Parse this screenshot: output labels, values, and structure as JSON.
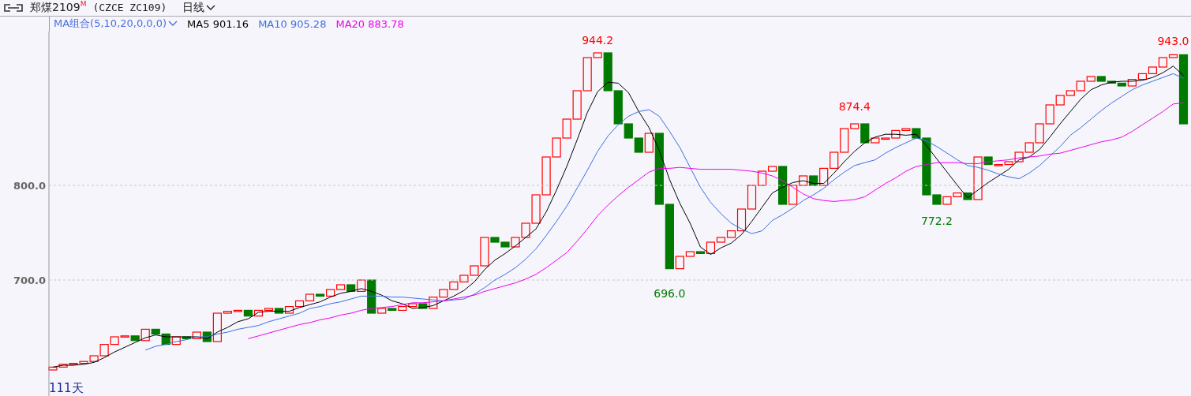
{
  "toolbar": {
    "title": "郑煤2109$^{M}$",
    "code": "(CZCE ZC109)",
    "period": "日线"
  },
  "legend": {
    "group": "MA组合(5,10,20,0,0,0)",
    "items": [
      {
        "value": "901.16"
      },
      {
        "value": "905.28"
      },
      {
        "value": "883.78"
      }
    ]
  },
  "chart_data": {
    "type": "line",
    "ylim": [
      577.5,
      962.5
    ],
    "yticks": [
      {
        "value": 700,
        "label": "700.0"
      },
      {
        "value": 800,
        "label": "800.0"
      }
    ],
    "series": [
      {
        "name": "MA5",
        "color": "#000000",
        "values": [
          608,
          610,
          610,
          611,
          613,
          618,
          624,
          629,
          634,
          639,
          642,
          640,
          640,
          640,
          640,
          638,
          645,
          650,
          656,
          659,
          666,
          667,
          667,
          667,
          671,
          674,
          677,
          682,
          686,
          688,
          691,
          688,
          684,
          678,
          675,
          670,
          671,
          673,
          678,
          683,
          689,
          698,
          711,
          721,
          728,
          736,
          745,
          754,
          772,
          795,
          820,
          848,
          877,
          899,
          909,
          908,
          898,
          878,
          861,
          837,
          806,
          781,
          760,
          735,
          727,
          734,
          739,
          748,
          762,
          777,
          792,
          798,
          803,
          805,
          802,
          802,
          813,
          825,
          836,
          845,
          851,
          854,
          854,
          853,
          854,
          842,
          828,
          814,
          800,
          787,
          795,
          803,
          810,
          817,
          827,
          830,
          838,
          851,
          865,
          878,
          891,
          901,
          906,
          909,
          910,
          910,
          911,
          914,
          919,
          926,
          916
        ]
      },
      {
        "name": "MA10",
        "color": "#3b6fe0",
        "values": [
          null,
          null,
          null,
          null,
          null,
          null,
          null,
          null,
          null,
          626,
          630,
          632,
          635,
          637,
          640,
          640,
          643,
          645,
          648,
          650,
          652,
          656,
          659,
          662,
          665,
          670,
          672,
          675,
          677,
          680,
          683,
          683,
          683,
          682,
          682,
          681,
          680,
          679,
          678,
          679,
          680,
          685,
          692,
          700,
          706,
          713,
          722,
          733,
          747,
          762,
          778,
          797,
          816,
          836,
          852,
          864,
          873,
          878,
          880,
          873,
          857,
          840,
          819,
          798,
          782,
          770,
          760,
          754,
          749,
          752,
          763,
          769,
          776,
          784,
          790,
          797,
          806,
          814,
          821,
          824,
          827,
          834,
          840,
          845,
          850,
          847,
          841,
          834,
          827,
          821,
          819,
          816,
          812,
          809,
          807,
          813,
          821,
          831,
          841,
          853,
          861,
          870,
          879,
          887,
          894,
          901,
          906,
          910,
          914,
          918,
          913
        ]
      },
      {
        "name": "MA20",
        "color": "#ee00ee",
        "values": [
          null,
          null,
          null,
          null,
          null,
          null,
          null,
          null,
          null,
          null,
          null,
          null,
          null,
          null,
          null,
          null,
          null,
          null,
          null,
          638,
          641,
          644,
          647,
          650,
          653,
          655,
          658,
          660,
          663,
          665,
          668,
          670,
          671,
          672,
          674,
          676,
          676,
          677,
          678,
          680,
          682,
          684,
          688,
          691,
          694,
          697,
          701,
          706,
          713,
          721,
          729,
          741,
          754,
          768,
          779,
          789,
          798,
          806,
          814,
          818,
          818,
          819,
          818,
          817,
          817,
          817,
          817,
          816,
          815,
          813,
          810,
          805,
          798,
          791,
          786,
          784,
          783,
          784,
          785,
          788,
          795,
          802,
          808,
          815,
          820,
          822,
          824,
          824,
          824,
          823,
          823,
          825,
          826,
          827,
          829,
          830,
          831,
          833,
          834,
          837,
          840,
          843,
          846,
          848,
          851,
          857,
          864,
          871,
          878,
          886,
          887
        ]
      }
    ],
    "annotations": [
      "944.2",
      "696.0",
      "874.4",
      "772.2",
      "943.0"
    ]
  },
  "day_count": "111天"
}
